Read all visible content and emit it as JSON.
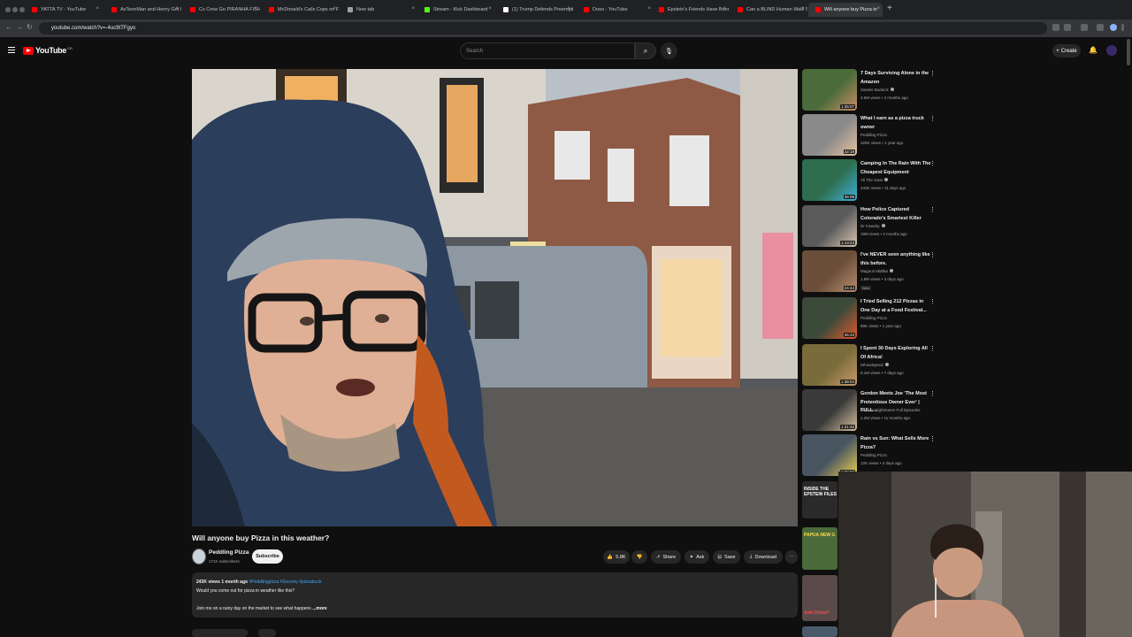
{
  "browser": {
    "tabs": [
      {
        "label": "YATTA TV - YouTube",
        "color": "#ff0000"
      },
      {
        "label": "AsTeonMan and Henry Get In",
        "color": "#ff0000"
      },
      {
        "label": "Cs Crew Go PIRANHA FISHIN",
        "color": "#ff0000"
      },
      {
        "label": "McDonald's Calls Cops on Fl",
        "color": "#ff0000"
      },
      {
        "label": "New tab",
        "color": "#9aa0a6"
      },
      {
        "label": "Stream - Kick Dashboard",
        "color": "#53fc18"
      },
      {
        "label": "(1) Trump Defends Preempti",
        "color": "#ffffff"
      },
      {
        "label": "Dooo - YouTube",
        "color": "#ff0000"
      },
      {
        "label": "Epstein's Friends Have Beer",
        "color": "#ff0000"
      },
      {
        "label": "Can a BLIND Human Walk St",
        "color": "#ff0000"
      },
      {
        "label": "Will anyone buy Pizza in",
        "color": "#ff0000"
      }
    ],
    "url": "youtube.com/watch?v=-4uc9tTFgyo"
  },
  "header": {
    "logo_text": "YouTube",
    "logo_country": "GB",
    "search_placeholder": "Search",
    "create_label": "Create"
  },
  "video": {
    "title": "Will anyone buy Pizza in this weather?",
    "channel": "Peddling Pizza",
    "subscribers": "171K subscribers",
    "subscribe_label": "Subscribe",
    "likes": "5.8K",
    "share_label": "Share",
    "ask_label": "Ask",
    "save_label": "Save",
    "download_label": "Download"
  },
  "description": {
    "views_age": "243K views  1 month ago",
    "hashtags": "#Peddlingpizza #Gozney #pizzatruck",
    "line1": "Would you come out for pizza in weather like this?",
    "line2": "Join me on a rainy day on the market to see what happens",
    "more_label": "...more"
  },
  "recommendations": [
    {
      "title": "7 Days Surviving Alone in the Amazon",
      "channel": "Xander Budnick",
      "meta": "3.6M views • 2 months ago",
      "duration": "1:25:07",
      "verified": true,
      "thumb_color": "#4a6b3a",
      "thumb_accent": "#c98d66"
    },
    {
      "title": "What I earn as a pizza truck owner",
      "channel": "Peddling Pizza",
      "meta": "329K views • 1 year ago",
      "duration": "42:19",
      "verified": false,
      "thumb_color": "#8a8a8a",
      "thumb_accent": "#e7c3a0"
    },
    {
      "title": "Camping In The Rain With The Cheapest Equipment",
      "channel": "Ali The Geat",
      "meta": "433K views • 11 days ago",
      "duration": "38:09",
      "verified": true,
      "thumb_color": "#2e6e4f",
      "thumb_accent": "#3fb0d8"
    },
    {
      "title": "How Police Captured Colorado's Smartest Killer",
      "channel": "Dr Insanity",
      "meta": "19M views • 2 months ago",
      "duration": "1:13:23",
      "verified": true,
      "thumb_color": "#5a5a5a",
      "thumb_accent": "#d9c6b0"
    },
    {
      "title": "I've NEVER seen anything like this before.",
      "channel": "Magnus Midtbø",
      "meta": "1.8M views • 3 days ago",
      "duration": "24:44",
      "verified": true,
      "new_label": "New",
      "thumb_color": "#6b4e3a",
      "thumb_accent": "#b98d70"
    },
    {
      "title": "I Tried Selling 212 Pizzas in One Day at a Food Festival...",
      "channel": "Peddling Pizza",
      "meta": "89K views • 1 year ago",
      "duration": "36:23",
      "verified": false,
      "thumb_color": "#3c4a3a",
      "thumb_accent": "#e05a2a"
    },
    {
      "title": "I Spent 30 Days Exploring All Of Africa!",
      "channel": "IShowSpeed",
      "meta": "5.1M views • 7 days ago",
      "duration": "1:38:04",
      "verified": true,
      "thumb_color": "#7a6b3a",
      "thumb_accent": "#c89a6a"
    },
    {
      "title": "Gordon Meets Joe 'The Most Pretentious Owner Ever' | FULL...",
      "channel": "Kitchen Nightmares Full Episodes",
      "meta": "1.2M views • 11 months ago",
      "duration": "1:21:32",
      "verified": false,
      "thumb_color": "#3a3a3a",
      "thumb_accent": "#d8c0a0"
    },
    {
      "title": "Rain vs Sun: What Sells More Pizza?",
      "channel": "Peddling Pizza",
      "meta": "12K views • 3 days ago",
      "duration": "1:00:00",
      "verified": false,
      "thumb_color": "#4a5562",
      "thumb_accent": "#e8d050"
    }
  ],
  "partial_thumbs": [
    {
      "label": "INSIDE THE EPSTEIN FILES",
      "color": "#2a2a2a"
    },
    {
      "label": "PAPUA NEW G",
      "color": "#4a6a3a"
    },
    {
      "label": "Anti Christ?",
      "color": "#5a4a4a"
    }
  ]
}
